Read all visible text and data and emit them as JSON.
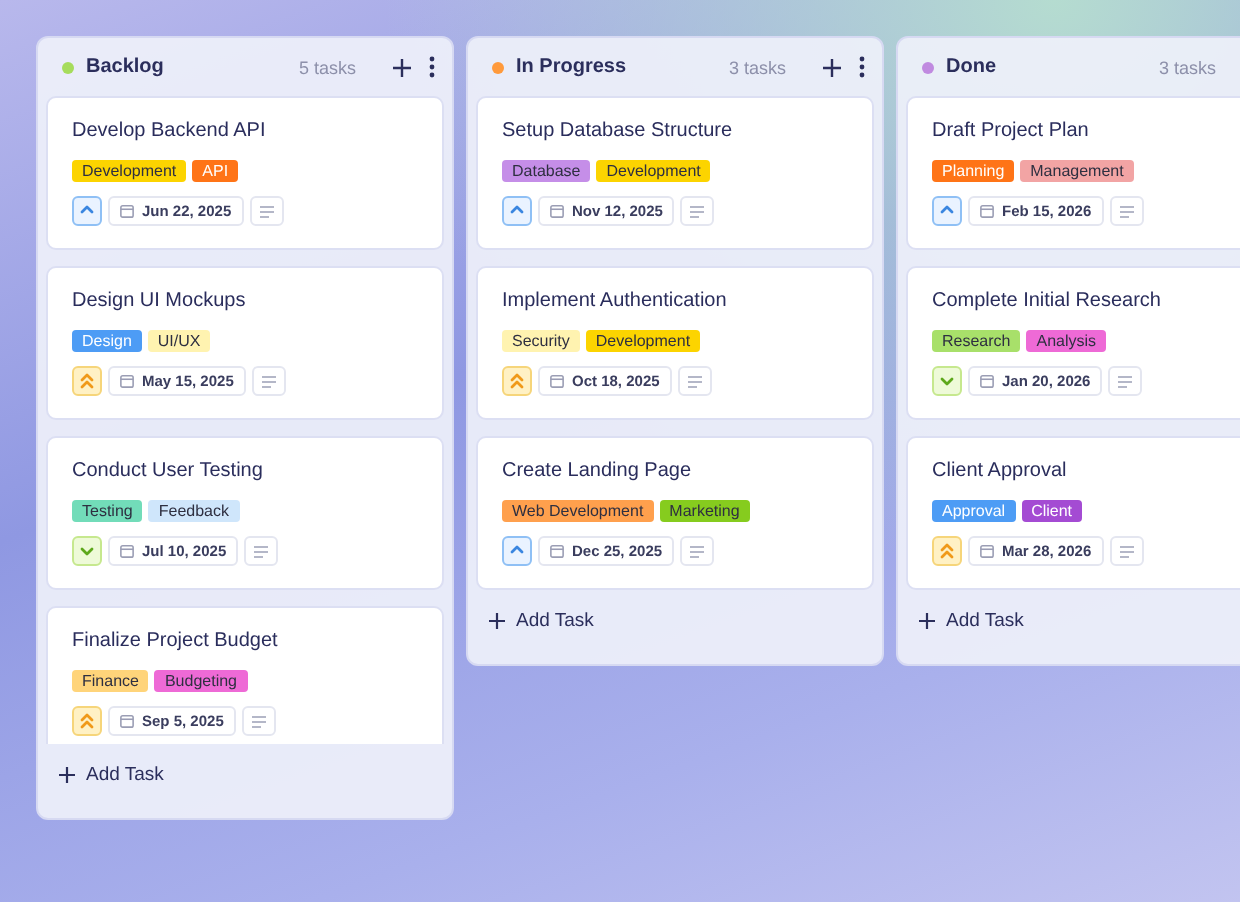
{
  "columns": [
    {
      "title": "Backlog",
      "color": "#a6dc5c",
      "count": "5 tasks",
      "add_label": "Add Task",
      "cards": [
        {
          "title": "Develop Backend API",
          "tags": [
            {
              "label": "Development",
              "color": "#fcd400"
            },
            {
              "label": "API",
              "color": "#ff7417"
            }
          ],
          "kind": "medium",
          "date": "Jun 22, 2025"
        },
        {
          "title": "Design UI Mockups",
          "tags": [
            {
              "label": "Design",
              "color": "#4d9cf5"
            },
            {
              "label": "UI/UX",
              "color": "#fff3b0"
            }
          ],
          "kind": "high",
          "date": "May 15, 2025"
        },
        {
          "title": "Conduct User Testing",
          "tags": [
            {
              "label": "Testing",
              "color": "#72dcb9"
            },
            {
              "label": "Feedback",
              "color": "#cfe6fb"
            }
          ],
          "kind": "low",
          "date": "Jul 10, 2025"
        },
        {
          "title": "Finalize Project Budget",
          "tags": [
            {
              "label": "Finance",
              "color": "#ffd47a"
            },
            {
              "label": "Budgeting",
              "color": "#ee6ad6"
            }
          ],
          "kind": "high",
          "date": "Sep 5, 2025"
        }
      ]
    },
    {
      "title": "In Progress",
      "color": "#ff9a3c",
      "count": "3 tasks",
      "add_label": "Add Task",
      "cards": [
        {
          "title": "Setup Database Structure",
          "tags": [
            {
              "label": "Database",
              "color": "#c58ee8"
            },
            {
              "label": "Development",
              "color": "#fcd400"
            }
          ],
          "kind": "medium",
          "date": "Nov 12, 2025"
        },
        {
          "title": "Implement Authentication",
          "tags": [
            {
              "label": "Security",
              "color": "#fff3b0"
            },
            {
              "label": "Development",
              "color": "#fcd400"
            }
          ],
          "kind": "high",
          "date": "Oct 18, 2025"
        },
        {
          "title": "Create Landing Page",
          "tags": [
            {
              "label": "Web Development",
              "color": "#ffa04d"
            },
            {
              "label": "Marketing",
              "color": "#86cc1e"
            }
          ],
          "kind": "medium",
          "date": "Dec 25, 2025"
        }
      ]
    },
    {
      "title": "Done",
      "color": "#c08ae0",
      "count": "3 tasks",
      "add_label": "Add Task",
      "cards": [
        {
          "title": "Draft Project Plan",
          "tags": [
            {
              "label": "Planning",
              "color": "#ff7417"
            },
            {
              "label": "Management",
              "color": "#f2a4a4"
            }
          ],
          "kind": "medium",
          "date": "Feb 15, 2026"
        },
        {
          "title": "Complete Initial Research",
          "tags": [
            {
              "label": "Research",
              "color": "#a8e06a"
            },
            {
              "label": "Analysis",
              "color": "#ee6ad6"
            }
          ],
          "kind": "low",
          "date": "Jan 20, 2026"
        },
        {
          "title": "Client Approval",
          "tags": [
            {
              "label": "Approval",
              "color": "#4d9cf5"
            },
            {
              "label": "Client",
              "color": "#a44bd3"
            }
          ],
          "kind": "high",
          "date": "Mar 28, 2026"
        }
      ]
    }
  ]
}
